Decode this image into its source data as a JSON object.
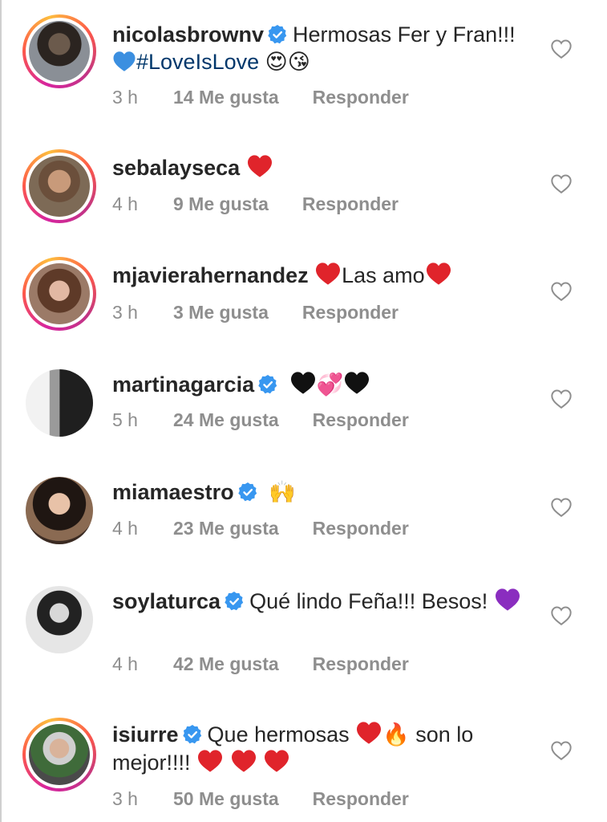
{
  "colors": {
    "text": "#262626",
    "muted": "#8e8e8e",
    "hashtag": "#00376b",
    "verified": "#3897f0",
    "red_heart": "#e0242b",
    "blue_heart": "#3b8fe0",
    "purple_heart": "#8a2dbf"
  },
  "comments": [
    {
      "username": "nicolasbrownv",
      "verified": true,
      "text_a": "Hermosas Fer y Fran!!! ",
      "hashtag": "#LoveIsLove",
      "time": "3 h",
      "likes": "14 Me gusta",
      "reply": "Responder"
    },
    {
      "username": "sebalayseca",
      "verified": false,
      "time": "4 h",
      "likes": "9 Me gusta",
      "reply": "Responder"
    },
    {
      "username": "mjavierahernandez",
      "verified": false,
      "text_a": "Las amo",
      "time": "3 h",
      "likes": "3 Me gusta",
      "reply": "Responder"
    },
    {
      "username": "martinagarcia",
      "verified": true,
      "time": "5 h",
      "likes": "24 Me gusta",
      "reply": "Responder"
    },
    {
      "username": "miamaestro",
      "verified": true,
      "time": "4 h",
      "likes": "23 Me gusta",
      "reply": "Responder"
    },
    {
      "username": "soylaturca",
      "verified": true,
      "text_a": "Qué lindo Feña!!! Besos!",
      "time": "4 h",
      "likes": "42 Me gusta",
      "reply": "Responder"
    },
    {
      "username": "isiurre",
      "verified": true,
      "text_a": "Que hermosas ",
      "text_b": " son lo mejor!!!! ",
      "time": "3 h",
      "likes": "50 Me gusta",
      "reply": "Responder"
    }
  ],
  "icons": {
    "like": "heart-outline-icon",
    "verified": "verified-badge-icon"
  }
}
